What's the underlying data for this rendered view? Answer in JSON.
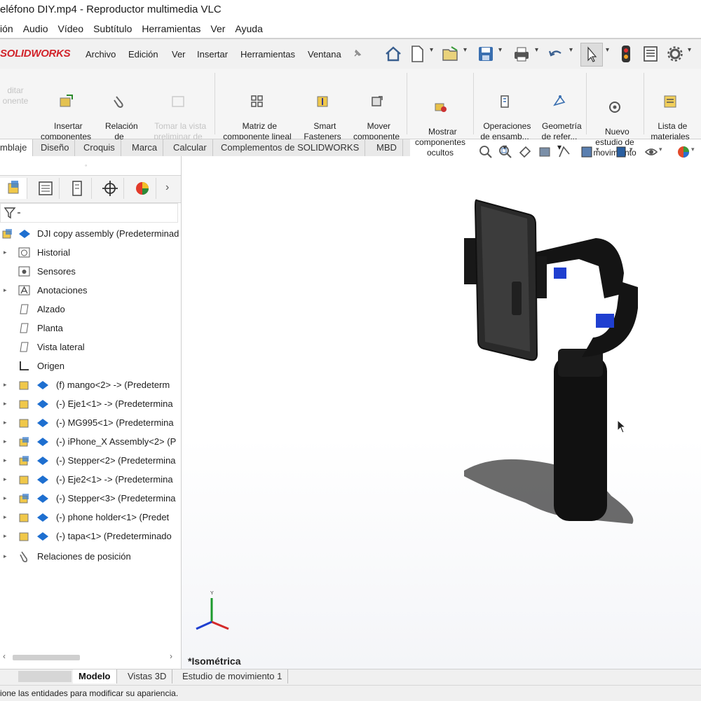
{
  "vlc": {
    "title": "eléfono DIY.mp4 - Reproductor multimedia VLC",
    "menu": [
      "ión",
      "Audio",
      "Vídeo",
      "Subtítulo",
      "Herramientas",
      "Ver",
      "Ayuda"
    ]
  },
  "sw": {
    "logo": "SOLIDWORKS",
    "menu": [
      "Archivo",
      "Edición",
      "Ver",
      "Insertar",
      "Herramientas",
      "Ventana"
    ],
    "commands": [
      {
        "label": "ditar\nonente",
        "enabled": false
      },
      {
        "label": "Insertar\ncomponentes\n▾",
        "enabled": true
      },
      {
        "label": "Relación\nde\nposición",
        "enabled": true
      },
      {
        "label": "Tomar la vista\npreliminar de\ncomponente",
        "enabled": false
      },
      {
        "label": "Matriz de\ncomponente lineal\n▾",
        "enabled": true
      },
      {
        "label": "Smart\nFasteners",
        "enabled": true
      },
      {
        "label": "Mover\ncomponente\n▾",
        "enabled": true
      },
      {
        "label": "Mostrar\ncomponentes\nocultos",
        "enabled": true
      },
      {
        "label": "Operaciones\nde ensamb...\n▾",
        "enabled": true
      },
      {
        "label": "Geometría\nde refer...\n▾",
        "enabled": true
      },
      {
        "label": "Nuevo\nestudio de\nmovimiento",
        "enabled": true
      },
      {
        "label": "Lista de\nmateriales",
        "enabled": true
      }
    ],
    "tabs": [
      "mblaje",
      "Diseño",
      "Croquis",
      "Marca",
      "Calcular",
      "Complementos de SOLIDWORKS",
      "MBD"
    ],
    "active_tab": "mblaje",
    "tree": {
      "root": "DJI copy assembly  (Predeterminad",
      "folders": [
        "Historial",
        "Sensores",
        "Anotaciones",
        "Alzado",
        "Planta",
        "Vista lateral",
        "Origen"
      ],
      "components": [
        "(f) mango<2> -> (Predeterm",
        "(-) Eje1<1> -> (Predetermina",
        "(-) MG995<1> (Predetermina",
        "(-) iPhone_X Assembly<2> (P",
        "(-) Stepper<2> (Predetermina",
        "(-) Eje2<1> -> (Predetermina",
        "(-) Stepper<3> (Predetermina",
        "(-) phone holder<1> (Predet",
        "(-) tapa<1> (Predeterminado"
      ],
      "mates": "Relaciones de posición"
    },
    "view_label": "*Isométrica",
    "bottom_tabs": [
      "Modelo",
      "Vistas 3D",
      "Estudio de movimiento 1"
    ],
    "active_bottom_tab": "Modelo",
    "status": "ione las entidades para modificar su apariencia.",
    "colors": {
      "logo_red": "#d2232a",
      "model_black": "#111111",
      "accent_blue": "#1f3fd0"
    }
  }
}
